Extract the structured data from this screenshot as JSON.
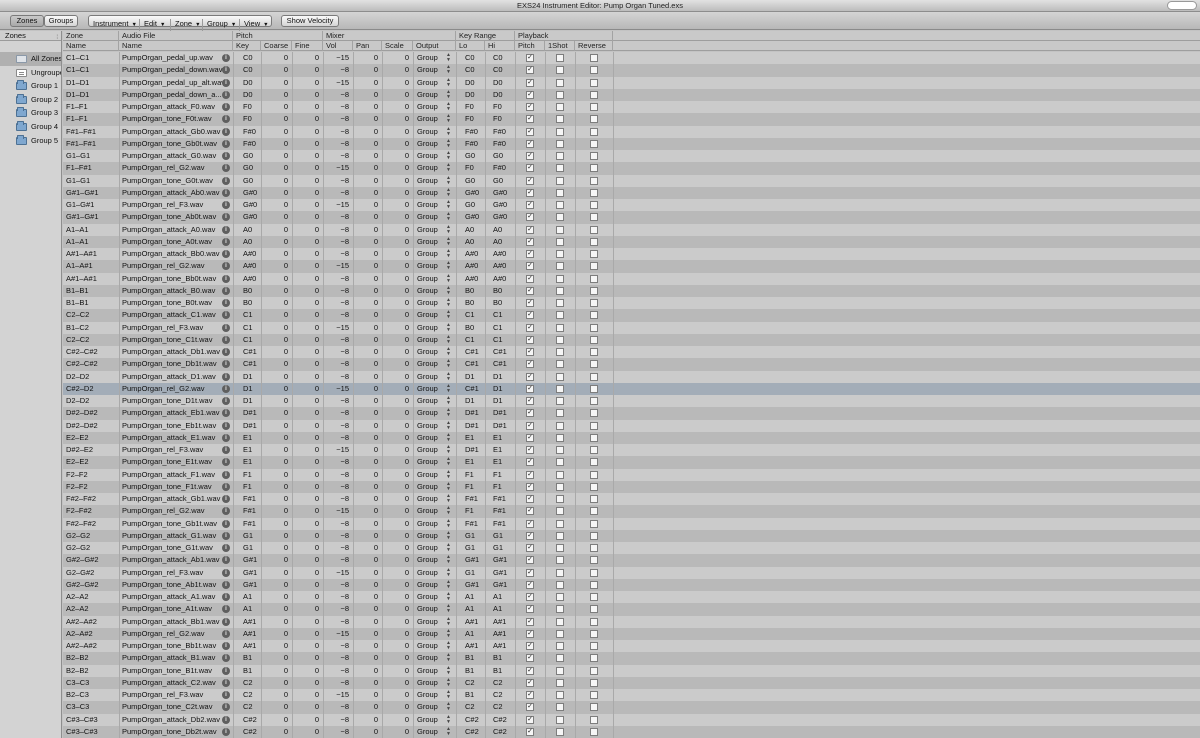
{
  "window": {
    "title": "EXS24 Instrument Editor: Pump Organ Tuned.exs"
  },
  "toolbar": {
    "zones_label": "Zones",
    "groups_label": "Groups",
    "menus": [
      "Instrument",
      "Edit",
      "Zone",
      "Group",
      "View"
    ],
    "show_velocity_label": "Show Velocity"
  },
  "sidebar": {
    "header": "Zones",
    "items": [
      "All Zones",
      "Ungrouped",
      "Group 1",
      "Group 2",
      "Group 3",
      "Group 4",
      "Group 5"
    ],
    "item_icons": [
      "all-zones-icon",
      "ungrouped-icon",
      "folder-icon",
      "folder-icon",
      "folder-icon",
      "folder-icon",
      "folder-icon"
    ]
  },
  "headers": {
    "top": {
      "zone": "Zone",
      "audio": "Audio File",
      "pitch": "Pitch",
      "mixer": "Mixer",
      "keyrange": "Key Range",
      "playback": "Playback"
    },
    "sub": {
      "name": "Name",
      "file": "Name",
      "key": "Key",
      "coarse": "Coarse",
      "fine": "Fine",
      "vol": "Vol",
      "pan": "Pan",
      "scale": "Scale",
      "output": "Output",
      "lo": "Lo",
      "hi": "Hi",
      "pitch": "Pitch",
      "oneshot": "1Shot",
      "reverse": "Reverse"
    }
  },
  "selected_row": 27,
  "rows": [
    {
      "zone": "C1–C1",
      "file": "PumpOrgan_pedal_up.wav",
      "key": "C0",
      "coarse": "0",
      "fine": "0",
      "vol": "−15",
      "pan": "0",
      "scale": "0",
      "output": "Group",
      "lo": "C0",
      "hi": "C0",
      "pitch": true,
      "oneshot": false,
      "reverse": false
    },
    {
      "zone": "C1–C1",
      "file": "PumpOrgan_pedal_down.wav",
      "key": "C0",
      "coarse": "0",
      "fine": "0",
      "vol": "−8",
      "pan": "0",
      "scale": "0",
      "output": "Group",
      "lo": "C0",
      "hi": "C0",
      "pitch": true,
      "oneshot": false,
      "reverse": false
    },
    {
      "zone": "D1–D1",
      "file": "PumpOrgan_pedal_up_alt.wav",
      "key": "D0",
      "coarse": "0",
      "fine": "0",
      "vol": "−15",
      "pan": "0",
      "scale": "0",
      "output": "Group",
      "lo": "D0",
      "hi": "D0",
      "pitch": true,
      "oneshot": false,
      "reverse": false
    },
    {
      "zone": "D1–D1",
      "file": "PumpOrgan_pedal_down_a...",
      "key": "D0",
      "coarse": "0",
      "fine": "0",
      "vol": "−8",
      "pan": "0",
      "scale": "0",
      "output": "Group",
      "lo": "D0",
      "hi": "D0",
      "pitch": true,
      "oneshot": false,
      "reverse": false
    },
    {
      "zone": "F1–F1",
      "file": "PumpOrgan_attack_F0.wav",
      "key": "F0",
      "coarse": "0",
      "fine": "0",
      "vol": "−8",
      "pan": "0",
      "scale": "0",
      "output": "Group",
      "lo": "F0",
      "hi": "F0",
      "pitch": true,
      "oneshot": false,
      "reverse": false
    },
    {
      "zone": "F1–F1",
      "file": "PumpOrgan_tone_F0t.wav",
      "key": "F0",
      "coarse": "0",
      "fine": "0",
      "vol": "−8",
      "pan": "0",
      "scale": "0",
      "output": "Group",
      "lo": "F0",
      "hi": "F0",
      "pitch": true,
      "oneshot": false,
      "reverse": false
    },
    {
      "zone": "F#1–F#1",
      "file": "PumpOrgan_attack_Gb0.wav",
      "key": "F#0",
      "coarse": "0",
      "fine": "0",
      "vol": "−8",
      "pan": "0",
      "scale": "0",
      "output": "Group",
      "lo": "F#0",
      "hi": "F#0",
      "pitch": true,
      "oneshot": false,
      "reverse": false
    },
    {
      "zone": "F#1–F#1",
      "file": "PumpOrgan_tone_Gb0t.wav",
      "key": "F#0",
      "coarse": "0",
      "fine": "0",
      "vol": "−8",
      "pan": "0",
      "scale": "0",
      "output": "Group",
      "lo": "F#0",
      "hi": "F#0",
      "pitch": true,
      "oneshot": false,
      "reverse": false
    },
    {
      "zone": "G1–G1",
      "file": "PumpOrgan_attack_G0.wav",
      "key": "G0",
      "coarse": "0",
      "fine": "0",
      "vol": "−8",
      "pan": "0",
      "scale": "0",
      "output": "Group",
      "lo": "G0",
      "hi": "G0",
      "pitch": true,
      "oneshot": false,
      "reverse": false
    },
    {
      "zone": "F1–F#1",
      "file": "PumpOrgan_rel_G2.wav",
      "key": "G0",
      "coarse": "0",
      "fine": "0",
      "vol": "−15",
      "pan": "0",
      "scale": "0",
      "output": "Group",
      "lo": "F0",
      "hi": "F#0",
      "pitch": true,
      "oneshot": false,
      "reverse": false
    },
    {
      "zone": "G1–G1",
      "file": "PumpOrgan_tone_G0t.wav",
      "key": "G0",
      "coarse": "0",
      "fine": "0",
      "vol": "−8",
      "pan": "0",
      "scale": "0",
      "output": "Group",
      "lo": "G0",
      "hi": "G0",
      "pitch": true,
      "oneshot": false,
      "reverse": false
    },
    {
      "zone": "G#1–G#1",
      "file": "PumpOrgan_attack_Ab0.wav",
      "key": "G#0",
      "coarse": "0",
      "fine": "0",
      "vol": "−8",
      "pan": "0",
      "scale": "0",
      "output": "Group",
      "lo": "G#0",
      "hi": "G#0",
      "pitch": true,
      "oneshot": false,
      "reverse": false
    },
    {
      "zone": "G1–G#1",
      "file": "PumpOrgan_rel_F3.wav",
      "key": "G#0",
      "coarse": "0",
      "fine": "0",
      "vol": "−15",
      "pan": "0",
      "scale": "0",
      "output": "Group",
      "lo": "G0",
      "hi": "G#0",
      "pitch": true,
      "oneshot": false,
      "reverse": false
    },
    {
      "zone": "G#1–G#1",
      "file": "PumpOrgan_tone_Ab0t.wav",
      "key": "G#0",
      "coarse": "0",
      "fine": "0",
      "vol": "−8",
      "pan": "0",
      "scale": "0",
      "output": "Group",
      "lo": "G#0",
      "hi": "G#0",
      "pitch": true,
      "oneshot": false,
      "reverse": false
    },
    {
      "zone": "A1–A1",
      "file": "PumpOrgan_attack_A0.wav",
      "key": "A0",
      "coarse": "0",
      "fine": "0",
      "vol": "−8",
      "pan": "0",
      "scale": "0",
      "output": "Group",
      "lo": "A0",
      "hi": "A0",
      "pitch": true,
      "oneshot": false,
      "reverse": false
    },
    {
      "zone": "A1–A1",
      "file": "PumpOrgan_tone_A0t.wav",
      "key": "A0",
      "coarse": "0",
      "fine": "0",
      "vol": "−8",
      "pan": "0",
      "scale": "0",
      "output": "Group",
      "lo": "A0",
      "hi": "A0",
      "pitch": true,
      "oneshot": false,
      "reverse": false
    },
    {
      "zone": "A#1–A#1",
      "file": "PumpOrgan_attack_Bb0.wav",
      "key": "A#0",
      "coarse": "0",
      "fine": "0",
      "vol": "−8",
      "pan": "0",
      "scale": "0",
      "output": "Group",
      "lo": "A#0",
      "hi": "A#0",
      "pitch": true,
      "oneshot": false,
      "reverse": false
    },
    {
      "zone": "A1–A#1",
      "file": "PumpOrgan_rel_G2.wav",
      "key": "A#0",
      "coarse": "0",
      "fine": "0",
      "vol": "−15",
      "pan": "0",
      "scale": "0",
      "output": "Group",
      "lo": "A#0",
      "hi": "A#0",
      "pitch": true,
      "oneshot": false,
      "reverse": false
    },
    {
      "zone": "A#1–A#1",
      "file": "PumpOrgan_tone_Bb0t.wav",
      "key": "A#0",
      "coarse": "0",
      "fine": "0",
      "vol": "−8",
      "pan": "0",
      "scale": "0",
      "output": "Group",
      "lo": "A#0",
      "hi": "A#0",
      "pitch": true,
      "oneshot": false,
      "reverse": false
    },
    {
      "zone": "B1–B1",
      "file": "PumpOrgan_attack_B0.wav",
      "key": "B0",
      "coarse": "0",
      "fine": "0",
      "vol": "−8",
      "pan": "0",
      "scale": "0",
      "output": "Group",
      "lo": "B0",
      "hi": "B0",
      "pitch": true,
      "oneshot": false,
      "reverse": false
    },
    {
      "zone": "B1–B1",
      "file": "PumpOrgan_tone_B0t.wav",
      "key": "B0",
      "coarse": "0",
      "fine": "0",
      "vol": "−8",
      "pan": "0",
      "scale": "0",
      "output": "Group",
      "lo": "B0",
      "hi": "B0",
      "pitch": true,
      "oneshot": false,
      "reverse": false
    },
    {
      "zone": "C2–C2",
      "file": "PumpOrgan_attack_C1.wav",
      "key": "C1",
      "coarse": "0",
      "fine": "0",
      "vol": "−8",
      "pan": "0",
      "scale": "0",
      "output": "Group",
      "lo": "C1",
      "hi": "C1",
      "pitch": true,
      "oneshot": false,
      "reverse": false
    },
    {
      "zone": "B1–C2",
      "file": "PumpOrgan_rel_F3.wav",
      "key": "C1",
      "coarse": "0",
      "fine": "0",
      "vol": "−15",
      "pan": "0",
      "scale": "0",
      "output": "Group",
      "lo": "B0",
      "hi": "C1",
      "pitch": true,
      "oneshot": false,
      "reverse": false
    },
    {
      "zone": "C2–C2",
      "file": "PumpOrgan_tone_C1t.wav",
      "key": "C1",
      "coarse": "0",
      "fine": "0",
      "vol": "−8",
      "pan": "0",
      "scale": "0",
      "output": "Group",
      "lo": "C1",
      "hi": "C1",
      "pitch": true,
      "oneshot": false,
      "reverse": false
    },
    {
      "zone": "C#2–C#2",
      "file": "PumpOrgan_attack_Db1.wav",
      "key": "C#1",
      "coarse": "0",
      "fine": "0",
      "vol": "−8",
      "pan": "0",
      "scale": "0",
      "output": "Group",
      "lo": "C#1",
      "hi": "C#1",
      "pitch": true,
      "oneshot": false,
      "reverse": false
    },
    {
      "zone": "C#2–C#2",
      "file": "PumpOrgan_tone_Db1t.wav",
      "key": "C#1",
      "coarse": "0",
      "fine": "0",
      "vol": "−8",
      "pan": "0",
      "scale": "0",
      "output": "Group",
      "lo": "C#1",
      "hi": "C#1",
      "pitch": true,
      "oneshot": false,
      "reverse": false
    },
    {
      "zone": "D2–D2",
      "file": "PumpOrgan_attack_D1.wav",
      "key": "D1",
      "coarse": "0",
      "fine": "0",
      "vol": "−8",
      "pan": "0",
      "scale": "0",
      "output": "Group",
      "lo": "D1",
      "hi": "D1",
      "pitch": true,
      "oneshot": false,
      "reverse": false
    },
    {
      "zone": "C#2–D2",
      "file": "PumpOrgan_rel_G2.wav",
      "key": "D1",
      "coarse": "0",
      "fine": "0",
      "vol": "−15",
      "pan": "0",
      "scale": "0",
      "output": "Group",
      "lo": "C#1",
      "hi": "D1",
      "pitch": true,
      "oneshot": false,
      "reverse": false
    },
    {
      "zone": "D2–D2",
      "file": "PumpOrgan_tone_D1t.wav",
      "key": "D1",
      "coarse": "0",
      "fine": "0",
      "vol": "−8",
      "pan": "0",
      "scale": "0",
      "output": "Group",
      "lo": "D1",
      "hi": "D1",
      "pitch": true,
      "oneshot": false,
      "reverse": false
    },
    {
      "zone": "D#2–D#2",
      "file": "PumpOrgan_attack_Eb1.wav",
      "key": "D#1",
      "coarse": "0",
      "fine": "0",
      "vol": "−8",
      "pan": "0",
      "scale": "0",
      "output": "Group",
      "lo": "D#1",
      "hi": "D#1",
      "pitch": true,
      "oneshot": false,
      "reverse": false
    },
    {
      "zone": "D#2–D#2",
      "file": "PumpOrgan_tone_Eb1t.wav",
      "key": "D#1",
      "coarse": "0",
      "fine": "0",
      "vol": "−8",
      "pan": "0",
      "scale": "0",
      "output": "Group",
      "lo": "D#1",
      "hi": "D#1",
      "pitch": true,
      "oneshot": false,
      "reverse": false
    },
    {
      "zone": "E2–E2",
      "file": "PumpOrgan_attack_E1.wav",
      "key": "E1",
      "coarse": "0",
      "fine": "0",
      "vol": "−8",
      "pan": "0",
      "scale": "0",
      "output": "Group",
      "lo": "E1",
      "hi": "E1",
      "pitch": true,
      "oneshot": false,
      "reverse": false
    },
    {
      "zone": "D#2–E2",
      "file": "PumpOrgan_rel_F3.wav",
      "key": "E1",
      "coarse": "0",
      "fine": "0",
      "vol": "−15",
      "pan": "0",
      "scale": "0",
      "output": "Group",
      "lo": "D#1",
      "hi": "E1",
      "pitch": true,
      "oneshot": false,
      "reverse": false
    },
    {
      "zone": "E2–E2",
      "file": "PumpOrgan_tone_E1t.wav",
      "key": "E1",
      "coarse": "0",
      "fine": "0",
      "vol": "−8",
      "pan": "0",
      "scale": "0",
      "output": "Group",
      "lo": "E1",
      "hi": "E1",
      "pitch": true,
      "oneshot": false,
      "reverse": false
    },
    {
      "zone": "F2–F2",
      "file": "PumpOrgan_attack_F1.wav",
      "key": "F1",
      "coarse": "0",
      "fine": "0",
      "vol": "−8",
      "pan": "0",
      "scale": "0",
      "output": "Group",
      "lo": "F1",
      "hi": "F1",
      "pitch": true,
      "oneshot": false,
      "reverse": false
    },
    {
      "zone": "F2–F2",
      "file": "PumpOrgan_tone_F1t.wav",
      "key": "F1",
      "coarse": "0",
      "fine": "0",
      "vol": "−8",
      "pan": "0",
      "scale": "0",
      "output": "Group",
      "lo": "F1",
      "hi": "F1",
      "pitch": true,
      "oneshot": false,
      "reverse": false
    },
    {
      "zone": "F#2–F#2",
      "file": "PumpOrgan_attack_Gb1.wav",
      "key": "F#1",
      "coarse": "0",
      "fine": "0",
      "vol": "−8",
      "pan": "0",
      "scale": "0",
      "output": "Group",
      "lo": "F#1",
      "hi": "F#1",
      "pitch": true,
      "oneshot": false,
      "reverse": false
    },
    {
      "zone": "F2–F#2",
      "file": "PumpOrgan_rel_G2.wav",
      "key": "F#1",
      "coarse": "0",
      "fine": "0",
      "vol": "−15",
      "pan": "0",
      "scale": "0",
      "output": "Group",
      "lo": "F1",
      "hi": "F#1",
      "pitch": true,
      "oneshot": false,
      "reverse": false
    },
    {
      "zone": "F#2–F#2",
      "file": "PumpOrgan_tone_Gb1t.wav",
      "key": "F#1",
      "coarse": "0",
      "fine": "0",
      "vol": "−8",
      "pan": "0",
      "scale": "0",
      "output": "Group",
      "lo": "F#1",
      "hi": "F#1",
      "pitch": true,
      "oneshot": false,
      "reverse": false
    },
    {
      "zone": "G2–G2",
      "file": "PumpOrgan_attack_G1.wav",
      "key": "G1",
      "coarse": "0",
      "fine": "0",
      "vol": "−8",
      "pan": "0",
      "scale": "0",
      "output": "Group",
      "lo": "G1",
      "hi": "G1",
      "pitch": true,
      "oneshot": false,
      "reverse": false
    },
    {
      "zone": "G2–G2",
      "file": "PumpOrgan_tone_G1t.wav",
      "key": "G1",
      "coarse": "0",
      "fine": "0",
      "vol": "−8",
      "pan": "0",
      "scale": "0",
      "output": "Group",
      "lo": "G1",
      "hi": "G1",
      "pitch": true,
      "oneshot": false,
      "reverse": false
    },
    {
      "zone": "G#2–G#2",
      "file": "PumpOrgan_attack_Ab1.wav",
      "key": "G#1",
      "coarse": "0",
      "fine": "0",
      "vol": "−8",
      "pan": "0",
      "scale": "0",
      "output": "Group",
      "lo": "G#1",
      "hi": "G#1",
      "pitch": true,
      "oneshot": false,
      "reverse": false
    },
    {
      "zone": "G2–G#2",
      "file": "PumpOrgan_rel_F3.wav",
      "key": "G#1",
      "coarse": "0",
      "fine": "0",
      "vol": "−15",
      "pan": "0",
      "scale": "0",
      "output": "Group",
      "lo": "G1",
      "hi": "G#1",
      "pitch": true,
      "oneshot": false,
      "reverse": false
    },
    {
      "zone": "G#2–G#2",
      "file": "PumpOrgan_tone_Ab1t.wav",
      "key": "G#1",
      "coarse": "0",
      "fine": "0",
      "vol": "−8",
      "pan": "0",
      "scale": "0",
      "output": "Group",
      "lo": "G#1",
      "hi": "G#1",
      "pitch": true,
      "oneshot": false,
      "reverse": false
    },
    {
      "zone": "A2–A2",
      "file": "PumpOrgan_attack_A1.wav",
      "key": "A1",
      "coarse": "0",
      "fine": "0",
      "vol": "−8",
      "pan": "0",
      "scale": "0",
      "output": "Group",
      "lo": "A1",
      "hi": "A1",
      "pitch": true,
      "oneshot": false,
      "reverse": false
    },
    {
      "zone": "A2–A2",
      "file": "PumpOrgan_tone_A1t.wav",
      "key": "A1",
      "coarse": "0",
      "fine": "0",
      "vol": "−8",
      "pan": "0",
      "scale": "0",
      "output": "Group",
      "lo": "A1",
      "hi": "A1",
      "pitch": true,
      "oneshot": false,
      "reverse": false
    },
    {
      "zone": "A#2–A#2",
      "file": "PumpOrgan_attack_Bb1.wav",
      "key": "A#1",
      "coarse": "0",
      "fine": "0",
      "vol": "−8",
      "pan": "0",
      "scale": "0",
      "output": "Group",
      "lo": "A#1",
      "hi": "A#1",
      "pitch": true,
      "oneshot": false,
      "reverse": false
    },
    {
      "zone": "A2–A#2",
      "file": "PumpOrgan_rel_G2.wav",
      "key": "A#1",
      "coarse": "0",
      "fine": "0",
      "vol": "−15",
      "pan": "0",
      "scale": "0",
      "output": "Group",
      "lo": "A1",
      "hi": "A#1",
      "pitch": true,
      "oneshot": false,
      "reverse": false
    },
    {
      "zone": "A#2–A#2",
      "file": "PumpOrgan_tone_Bb1t.wav",
      "key": "A#1",
      "coarse": "0",
      "fine": "0",
      "vol": "−8",
      "pan": "0",
      "scale": "0",
      "output": "Group",
      "lo": "A#1",
      "hi": "A#1",
      "pitch": true,
      "oneshot": false,
      "reverse": false
    },
    {
      "zone": "B2–B2",
      "file": "PumpOrgan_attack_B1.wav",
      "key": "B1",
      "coarse": "0",
      "fine": "0",
      "vol": "−8",
      "pan": "0",
      "scale": "0",
      "output": "Group",
      "lo": "B1",
      "hi": "B1",
      "pitch": true,
      "oneshot": false,
      "reverse": false
    },
    {
      "zone": "B2–B2",
      "file": "PumpOrgan_tone_B1t.wav",
      "key": "B1",
      "coarse": "0",
      "fine": "0",
      "vol": "−8",
      "pan": "0",
      "scale": "0",
      "output": "Group",
      "lo": "B1",
      "hi": "B1",
      "pitch": true,
      "oneshot": false,
      "reverse": false
    },
    {
      "zone": "C3–C3",
      "file": "PumpOrgan_attack_C2.wav",
      "key": "C2",
      "coarse": "0",
      "fine": "0",
      "vol": "−8",
      "pan": "0",
      "scale": "0",
      "output": "Group",
      "lo": "C2",
      "hi": "C2",
      "pitch": true,
      "oneshot": false,
      "reverse": false
    },
    {
      "zone": "B2–C3",
      "file": "PumpOrgan_rel_F3.wav",
      "key": "C2",
      "coarse": "0",
      "fine": "0",
      "vol": "−15",
      "pan": "0",
      "scale": "0",
      "output": "Group",
      "lo": "B1",
      "hi": "C2",
      "pitch": true,
      "oneshot": false,
      "reverse": false
    },
    {
      "zone": "C3–C3",
      "file": "PumpOrgan_tone_C2t.wav",
      "key": "C2",
      "coarse": "0",
      "fine": "0",
      "vol": "−8",
      "pan": "0",
      "scale": "0",
      "output": "Group",
      "lo": "C2",
      "hi": "C2",
      "pitch": true,
      "oneshot": false,
      "reverse": false
    },
    {
      "zone": "C#3–C#3",
      "file": "PumpOrgan_attack_Db2.wav",
      "key": "C#2",
      "coarse": "0",
      "fine": "0",
      "vol": "−8",
      "pan": "0",
      "scale": "0",
      "output": "Group",
      "lo": "C#2",
      "hi": "C#2",
      "pitch": true,
      "oneshot": false,
      "reverse": false
    },
    {
      "zone": "C#3–C#3",
      "file": "PumpOrgan_tone_Db2t.wav",
      "key": "C#2",
      "coarse": "0",
      "fine": "0",
      "vol": "−8",
      "pan": "0",
      "scale": "0",
      "output": "Group",
      "lo": "C#2",
      "hi": "C#2",
      "pitch": true,
      "oneshot": false,
      "reverse": false
    }
  ]
}
